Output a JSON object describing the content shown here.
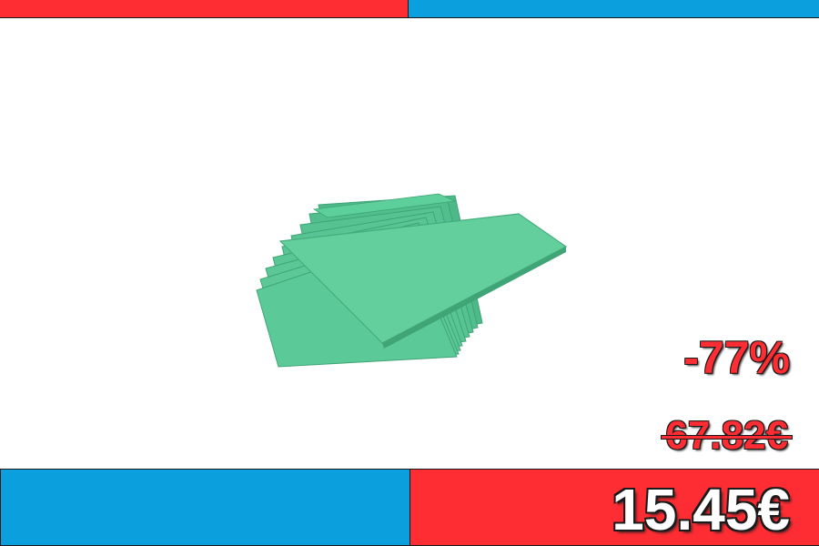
{
  "promo": {
    "discount": "-77%",
    "old_price": "67.82€",
    "current_price": "15.45€"
  },
  "product": {
    "image": "green-paper-sheets-stack"
  },
  "colors": {
    "red": "#fe2d33",
    "blue": "#0ba0dd",
    "sheet_green": "#5ccf9a"
  }
}
